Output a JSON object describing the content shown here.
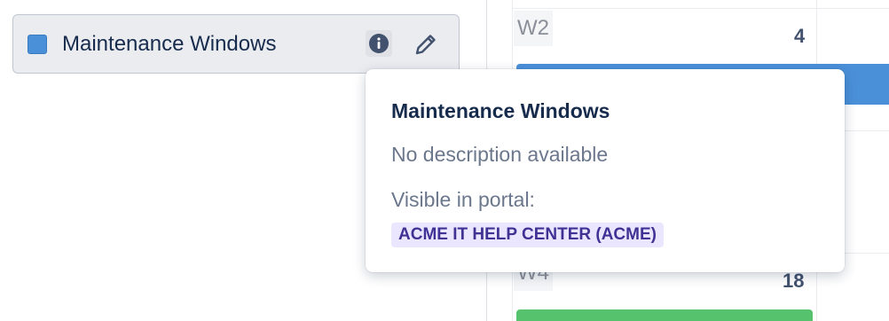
{
  "sidebar": {
    "calendar_item": {
      "label": "Maintenance Windows",
      "color": "#4a90d9",
      "info_icon": "info-icon",
      "edit_icon": "pencil-icon"
    }
  },
  "calendar": {
    "weeks": [
      {
        "label": "W2",
        "day": "4"
      },
      {
        "label": "W4",
        "day": "18"
      }
    ],
    "event_colors": {
      "blue": "#4a90d9",
      "green": "#57c26d"
    }
  },
  "popover": {
    "title": "Maintenance Windows",
    "description": "No description available",
    "visible_label": "Visible in portal:",
    "portal_tag": "ACME IT HELP CENTER (ACME)"
  }
}
